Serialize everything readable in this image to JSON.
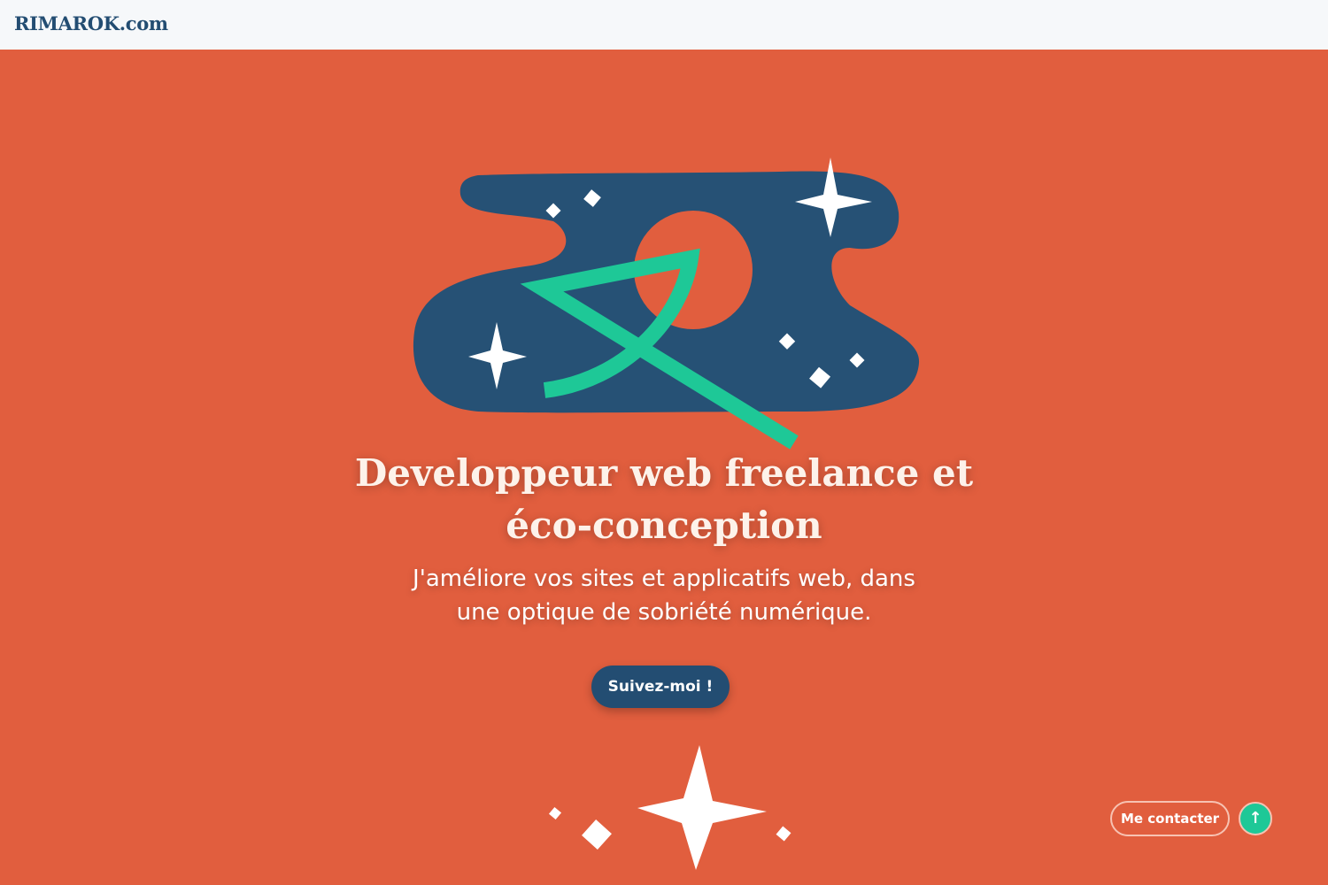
{
  "header": {
    "logo_text": "RIMAROK.com"
  },
  "hero": {
    "headline_line1": "Developpeur web freelance et",
    "headline_line2": "éco-conception",
    "subtitle_line1": "J'améliore vos sites et applicatifs web, dans",
    "subtitle_line2": "une optique de sobriété numérique.",
    "cta_label": "Suivez-moi !"
  },
  "floating": {
    "contact_label": "Me contacter",
    "scroll_top_icon": "arrow-up-icon",
    "scroll_top_glyph": "↑"
  },
  "colors": {
    "background": "#e15e3e",
    "navy": "#234d72",
    "green": "#1ec897",
    "topbar": "#f6f8fa"
  }
}
